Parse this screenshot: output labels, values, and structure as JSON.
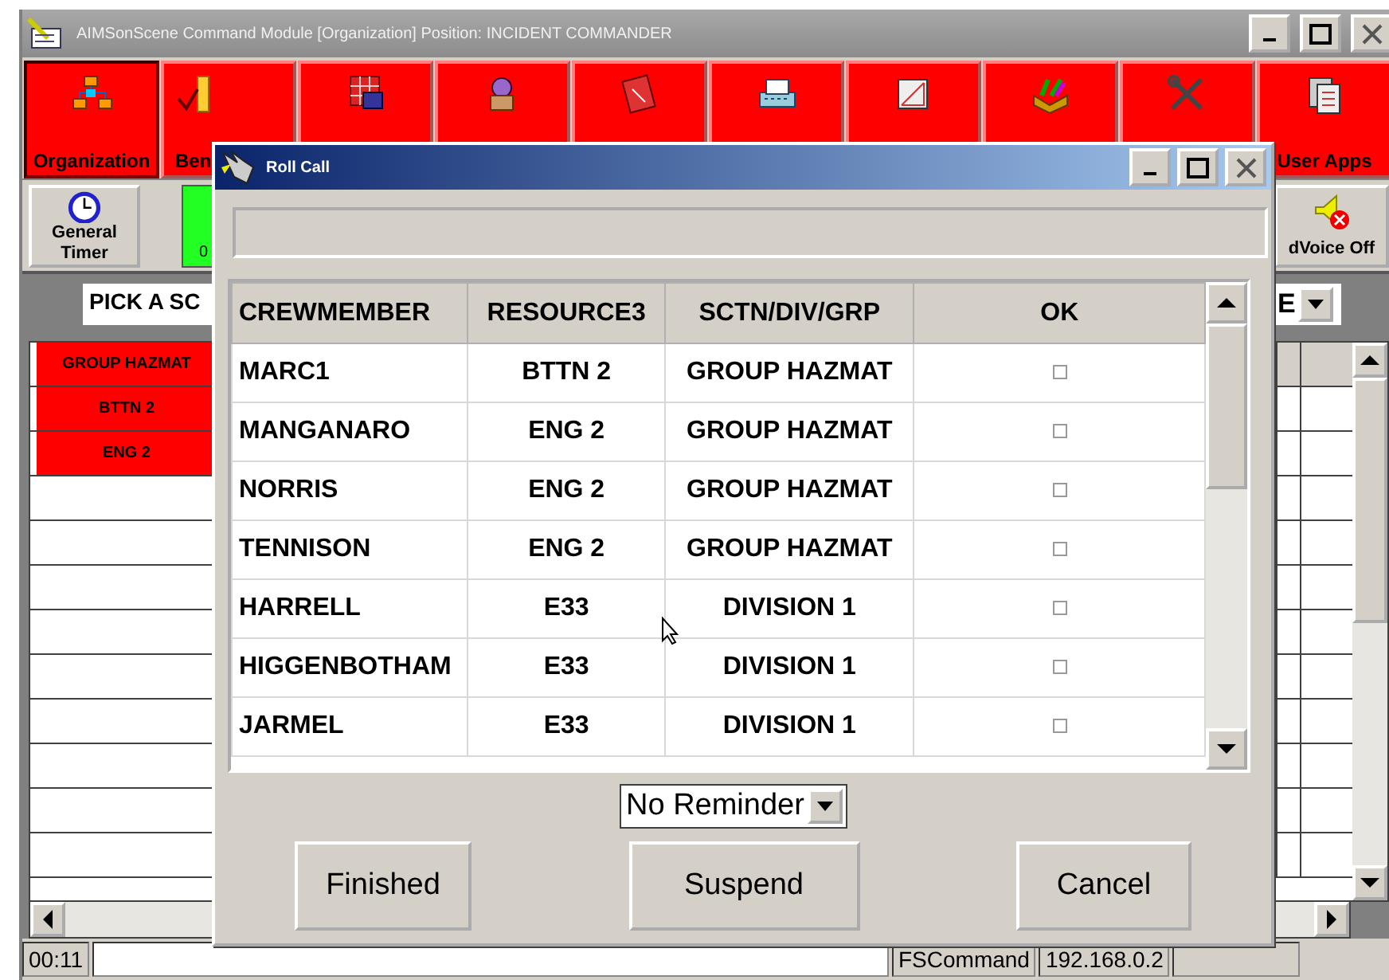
{
  "window": {
    "title": "AIMSonScene Command Module [Organization] Position: INCIDENT COMMANDER"
  },
  "toolbar": [
    {
      "kind": "labeled",
      "label": "Organization"
    },
    {
      "kind": "labeled",
      "label": "Ben"
    },
    {
      "kind": "icon"
    },
    {
      "kind": "icon"
    },
    {
      "kind": "icon"
    },
    {
      "kind": "icon"
    },
    {
      "kind": "icon"
    },
    {
      "kind": "icon"
    },
    {
      "kind": "icon"
    },
    {
      "kind": "labeled",
      "label": "User Apps"
    }
  ],
  "secondary": {
    "timer_button": "General Timer",
    "counter": "0",
    "voice_button": "dVoice Off"
  },
  "pick": {
    "field": "PICK A SC",
    "dropdown": "E"
  },
  "grid": {
    "rows": [
      {
        "unit": "GROUP HAZMAT"
      },
      {
        "unit": "BTTN 2"
      },
      {
        "unit": "ENG 2"
      }
    ]
  },
  "status_bar": {
    "time": "00:11",
    "mode": "FSCommand",
    "address": "192.168.0.2"
  },
  "dialog": {
    "title": "Roll Call",
    "columns": [
      "CREWMEMBER",
      "RESOURCE3",
      "SCTN/DIV/GRP",
      "OK"
    ],
    "rows": [
      {
        "crewmember": "MARC1",
        "resource": "BTTN 2",
        "group": "GROUP HAZMAT",
        "ok": false
      },
      {
        "crewmember": "MANGANARO",
        "resource": "ENG 2",
        "group": "GROUP HAZMAT",
        "ok": false
      },
      {
        "crewmember": "NORRIS",
        "resource": "ENG 2",
        "group": "GROUP HAZMAT",
        "ok": false
      },
      {
        "crewmember": "TENNISON",
        "resource": "ENG 2",
        "group": "GROUP HAZMAT",
        "ok": false
      },
      {
        "crewmember": "HARRELL",
        "resource": "E33",
        "group": "DIVISION 1",
        "ok": false
      },
      {
        "crewmember": "HIGGENBOTHAM",
        "resource": "E33",
        "group": "DIVISION 1",
        "ok": false
      },
      {
        "crewmember": "JARMEL",
        "resource": "E33",
        "group": "DIVISION 1",
        "ok": false
      }
    ],
    "reminder": "No Reminder",
    "buttons": [
      "Finished",
      "Suspend",
      "Cancel"
    ]
  }
}
